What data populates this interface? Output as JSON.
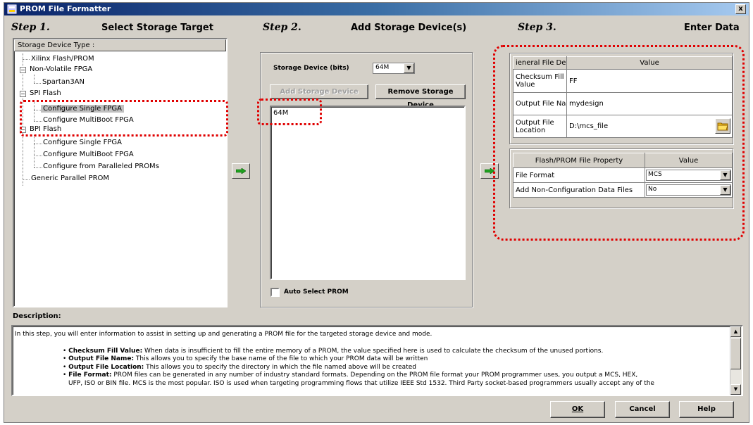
{
  "window": {
    "title": "PROM File Formatter",
    "close_label": "x"
  },
  "step1": {
    "number": "Step 1.",
    "title": "Select Storage Target",
    "header": "Storage Device Type :",
    "tree": {
      "xilinx": "Xilinx Flash/PROM",
      "nonvolatile": "Non-Volatile FPGA",
      "spartan": "Spartan3AN",
      "spi": "SPI Flash",
      "spi_single": "Configure Single FPGA",
      "spi_multiboot": "Configure MultiBoot FPGA",
      "bpi": "BPI Flash",
      "bpi_single": "Configure Single FPGA",
      "bpi_multiboot": "Configure MultiBoot FPGA",
      "bpi_parallel": "Configure from Paralleled PROMs",
      "generic": "Generic Parallel PROM"
    }
  },
  "step2": {
    "number": "Step 2.",
    "title": "Add Storage Device(s)",
    "size_label": "Storage Device (bits)",
    "size_value": "64M",
    "add_button": "Add Storage Device",
    "remove_button": "Remove Storage Device",
    "devices": [
      "64M"
    ],
    "auto_select_label": "Auto Select PROM"
  },
  "step3": {
    "number": "Step 3.",
    "title": "Enter Data",
    "general": {
      "col1": "ieneral File Detai",
      "col2": "Value",
      "checksum_label_1": "Checksum Fill",
      "checksum_label_2": "Value",
      "checksum_value": "FF",
      "outname_label": "Output File Name",
      "outname_value": "mydesign",
      "outloc_label_1": "Output File",
      "outloc_label_2": "Location",
      "outloc_value": "D:\\mcs_file"
    },
    "property": {
      "col1": "Flash/PROM File Property",
      "col2": "Value",
      "format_label": "File Format",
      "format_value": "MCS",
      "nonconfig_label": "Add Non-Configuration Data Files",
      "nonconfig_value": "No"
    }
  },
  "description": {
    "label": "Description:",
    "intro": "In this step, you will enter information to assist in setting up and generating a PROM file for the targeted storage device and mode.",
    "items": [
      {
        "term": "Checksum Fill Value:",
        "text": " When data is insufficient to fill the entire memory of a PROM, the value specified here is used to calculate the checksum of the unused portions."
      },
      {
        "term": "Output File Name:",
        "text": " This allows you to specify the base name of the file to which your PROM data will be written"
      },
      {
        "term": "Output File Location:",
        "text": " This allows you to specify the directory in which the file named above will be created"
      },
      {
        "term": "File Format:",
        "text": " PROM files can be generated in any number of industry standard formats. Depending on the PROM file format your PROM programmer uses, you output a MCS, HEX,"
      }
    ],
    "overflow": "UFP, ISO or BIN file. MCS is the most popular. ISO is used when targeting programming flows that utilize IEEE Std 1532. Third Party socket-based programmers usually accept any of the"
  },
  "buttons": {
    "ok": "OK",
    "cancel": "Cancel",
    "help": "Help"
  },
  "colors": {
    "highlight": "#e00000",
    "face": "#d4d0c8",
    "title_start": "#0a246a"
  }
}
